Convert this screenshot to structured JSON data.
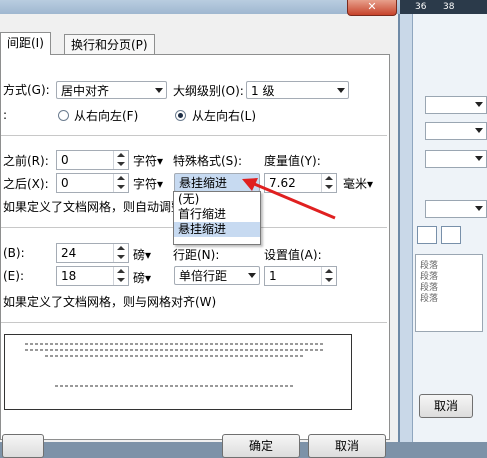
{
  "dialog": {
    "close_glyph": "✕",
    "tabs": [
      {
        "label": "间距(I)"
      },
      {
        "label": "换行和分页(P)"
      }
    ],
    "alignment": {
      "label": "方式(G):",
      "value": "居中对齐"
    },
    "outline_level": {
      "label": "大纲级别(O):",
      "value": "1 级"
    },
    "direction": {
      "rtl_label": "从右向左(F)",
      "ltr_label": "从左向右(L)",
      "selected": "ltr"
    },
    "indent": {
      "before_label": "之前(R):",
      "before_value": "0",
      "before_unit": "字符▾",
      "after_label": "之后(X):",
      "after_value": "0",
      "after_unit": "字符▾",
      "special_label": "特殊格式(S):",
      "special_value": "悬挂缩进",
      "measure_label": "度量值(Y):",
      "measure_value": "7.62",
      "measure_unit": "毫米▾",
      "grid_text": "如果定义了文档网格，则自动调整",
      "special_options": [
        "(无)",
        "首行缩进",
        "悬挂缩进"
      ],
      "special_highlighted": "悬挂缩进"
    },
    "spacing": {
      "before_label": "(B):",
      "before_value": "24",
      "before_unit": "磅▾",
      "after_label": "(E):",
      "after_value": "18",
      "after_unit": "磅▾",
      "line_label": "行距(N):",
      "line_value": "单倍行距",
      "setting_label": "设置值(A):",
      "setting_value": "1",
      "grid_text": "如果定义了文档网格，则与网格对齐(W)"
    },
    "buttons": {
      "ok": "确定",
      "cancel": "取消"
    }
  },
  "right_window": {
    "status_nums": [
      "36",
      "38"
    ],
    "preview_lines": [
      "段落",
      "段落",
      "段落",
      "段落"
    ],
    "cancel": "取消"
  },
  "colors": {
    "annotation_arrow": "#e02020",
    "selection": "#c7daf1"
  }
}
